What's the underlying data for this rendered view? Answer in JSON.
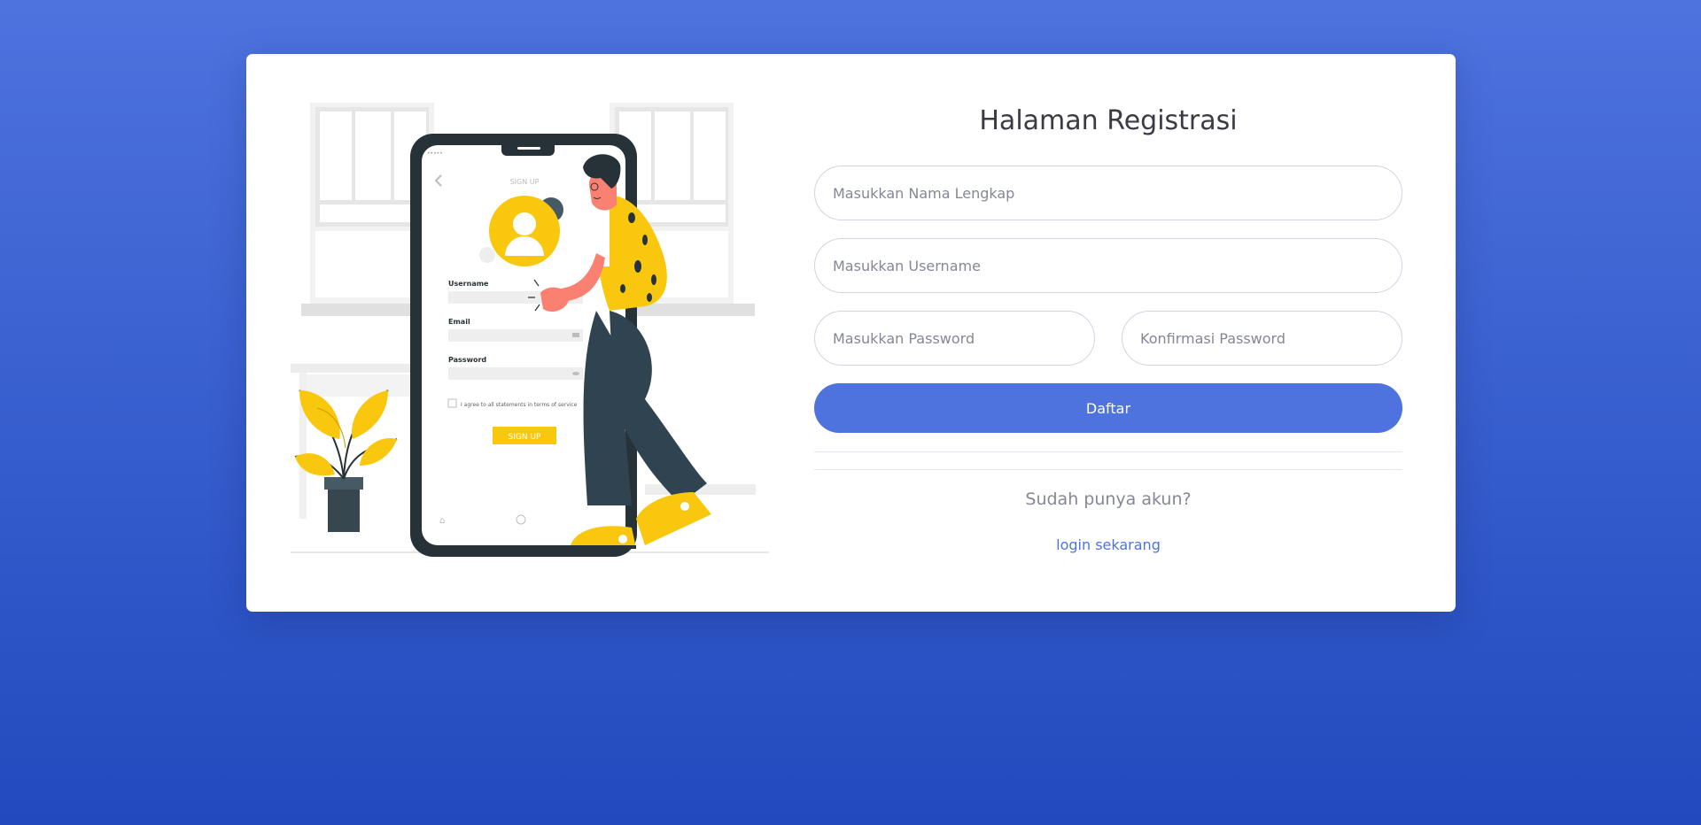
{
  "page": {
    "title": "Halaman Registrasi"
  },
  "form": {
    "fullname_placeholder": "Masukkan Nama Lengkap",
    "username_placeholder": "Masukkan Username",
    "password_placeholder": "Masukkan Password",
    "confirm_password_placeholder": "Konfirmasi Password",
    "submit_label": "Daftar"
  },
  "footer": {
    "question": "Sudah punya akun?",
    "login_link": "login sekarang"
  },
  "illustration": {
    "phone_screen_title": "SIGN UP",
    "username_label": "Username",
    "email_label": "Email",
    "password_label": "Password",
    "agree_text": "I agree to all statements in terms of service",
    "signup_button": "SIGN UP"
  },
  "colors": {
    "primary": "#4e73df",
    "accent_yellow": "#f9c80e",
    "dark": "#2f4450"
  }
}
